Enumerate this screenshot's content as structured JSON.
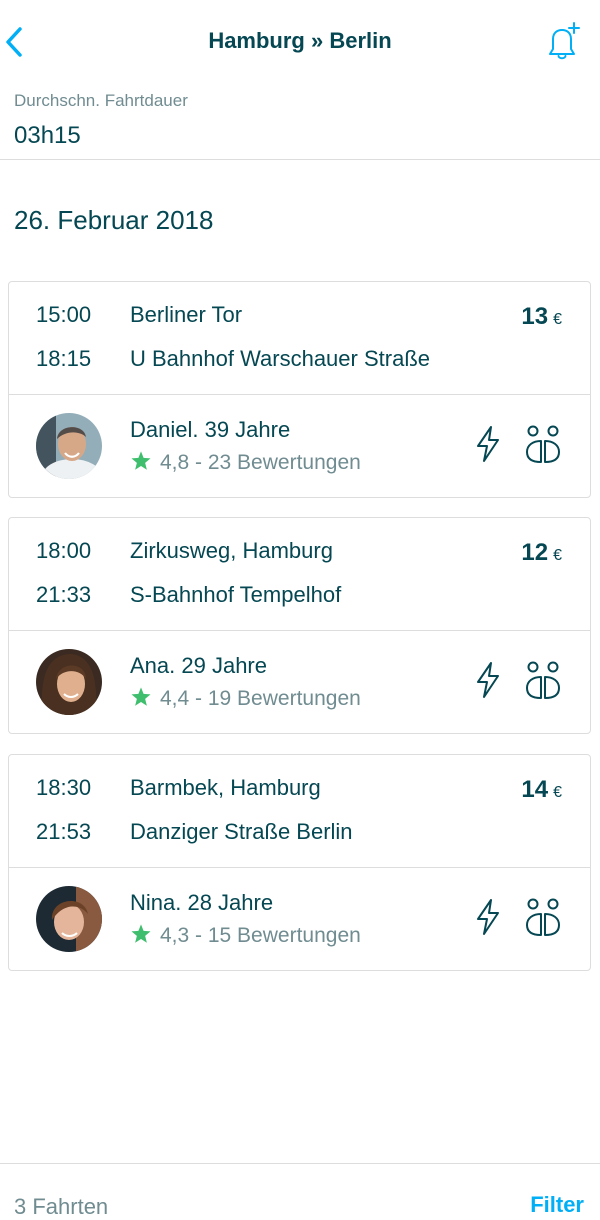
{
  "header": {
    "title": "Hamburg » Berlin"
  },
  "summary": {
    "avg_label": "Durchschn. Fahrtdauer",
    "avg_value": "03h15"
  },
  "date": "26. Februar 2018",
  "trips": [
    {
      "departure_time": "15:00",
      "departure_place": "Berliner Tor",
      "arrival_time": "18:15",
      "arrival_place": "U Bahnhof Warschauer Straße",
      "price": "13",
      "currency": "€",
      "driver": "Daniel. 39 Jahre",
      "rating": "4,8 - 23 Bewertungen"
    },
    {
      "departure_time": "18:00",
      "departure_place": "Zirkusweg, Hamburg",
      "arrival_time": "21:33",
      "arrival_place": "S-Bahnhof Tempelhof",
      "price": "12",
      "currency": "€",
      "driver": "Ana. 29 Jahre",
      "rating": "4,4 - 19 Bewertungen"
    },
    {
      "departure_time": "18:30",
      "departure_place": "Barmbek, Hamburg",
      "arrival_time": "21:53",
      "arrival_place": "Danziger Straße Berlin",
      "price": "14",
      "currency": "€",
      "driver": "Nina. 28 Jahre",
      "rating": "4,3 - 15 Bewertungen"
    }
  ],
  "footer": {
    "count": "3 Fahrten",
    "filter": "Filter"
  },
  "colors": {
    "primary_text": "#054752",
    "secondary_text": "#708c91",
    "accent": "#00aff5",
    "star": "#3fbe6d"
  }
}
